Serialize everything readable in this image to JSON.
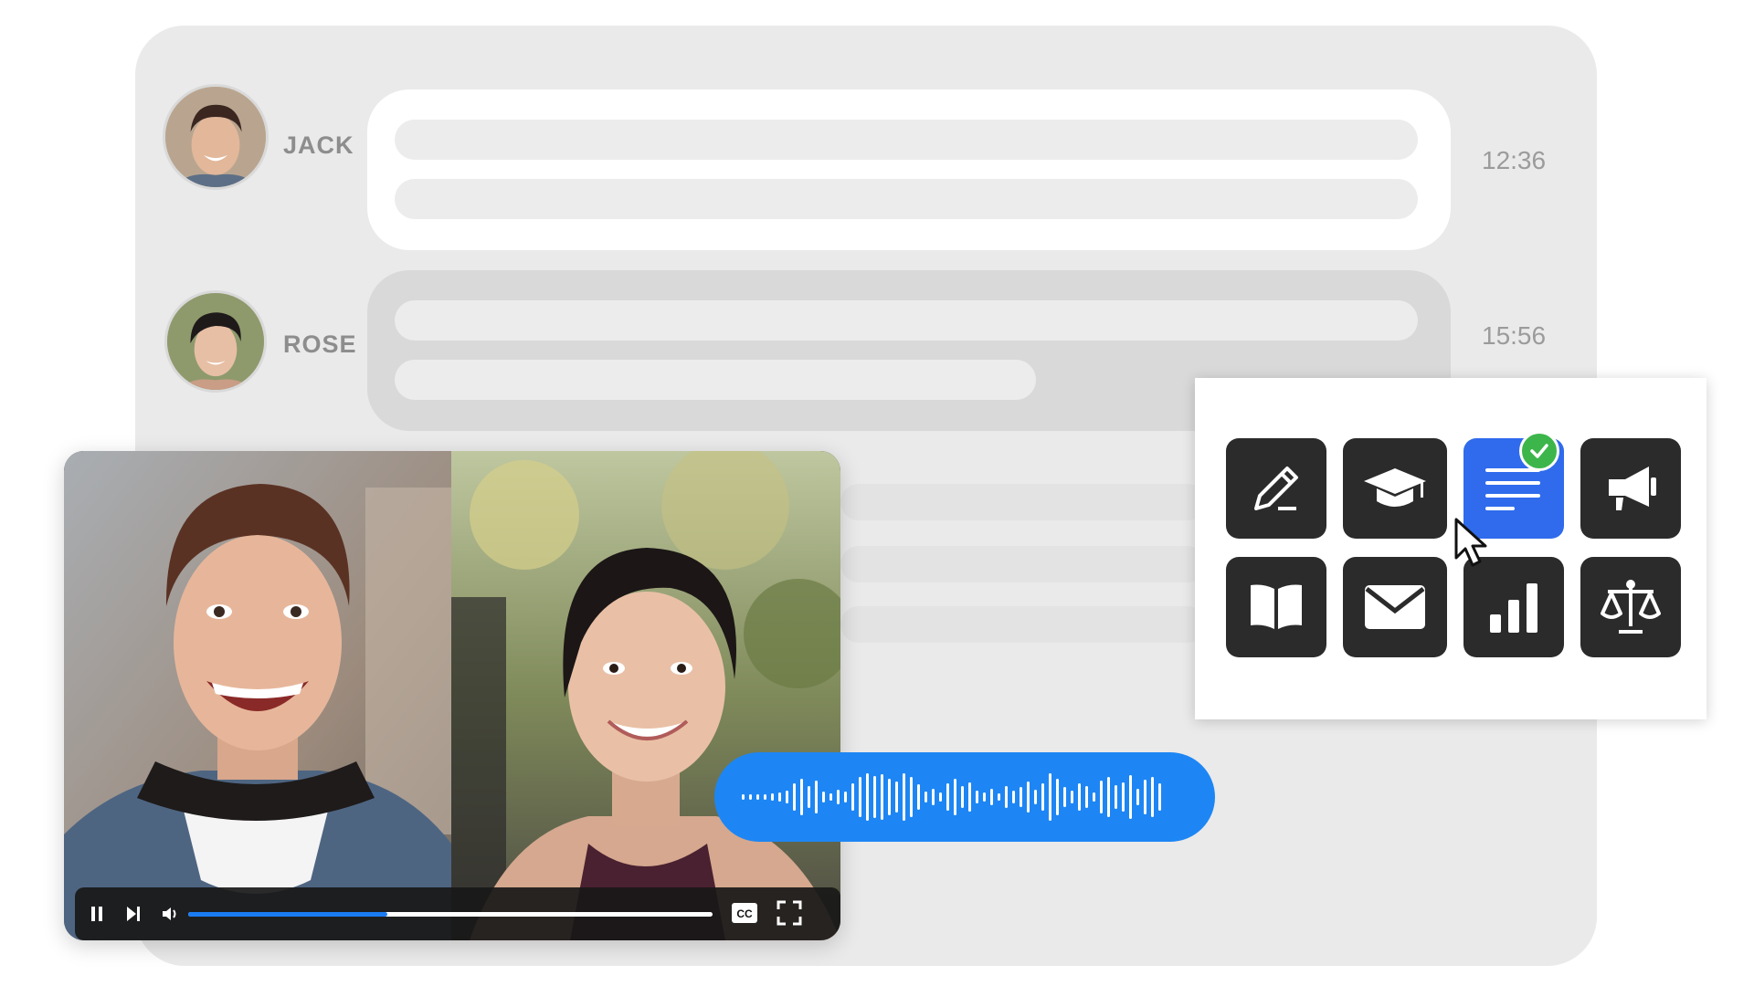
{
  "messages": [
    {
      "name": "JACK",
      "time": "12:36"
    },
    {
      "name": "ROSE",
      "time": "15:56"
    }
  ],
  "video": {
    "progress": 0.38,
    "captions_label": "CC"
  },
  "templates": [
    {
      "icon": "pencil-icon",
      "selected": false
    },
    {
      "icon": "graduation-cap-icon",
      "selected": false
    },
    {
      "icon": "text-lines-icon",
      "selected": true
    },
    {
      "icon": "megaphone-icon",
      "selected": false
    },
    {
      "icon": "open-book-icon",
      "selected": false
    },
    {
      "icon": "envelope-icon",
      "selected": false
    },
    {
      "icon": "bar-chart-icon",
      "selected": false
    },
    {
      "icon": "scales-icon",
      "selected": false
    }
  ],
  "colors": {
    "accent_blue": "#1d86f4",
    "selected_blue": "#2f6bec",
    "check_green": "#3cb64a",
    "tile_dark": "#2b2b2b"
  }
}
